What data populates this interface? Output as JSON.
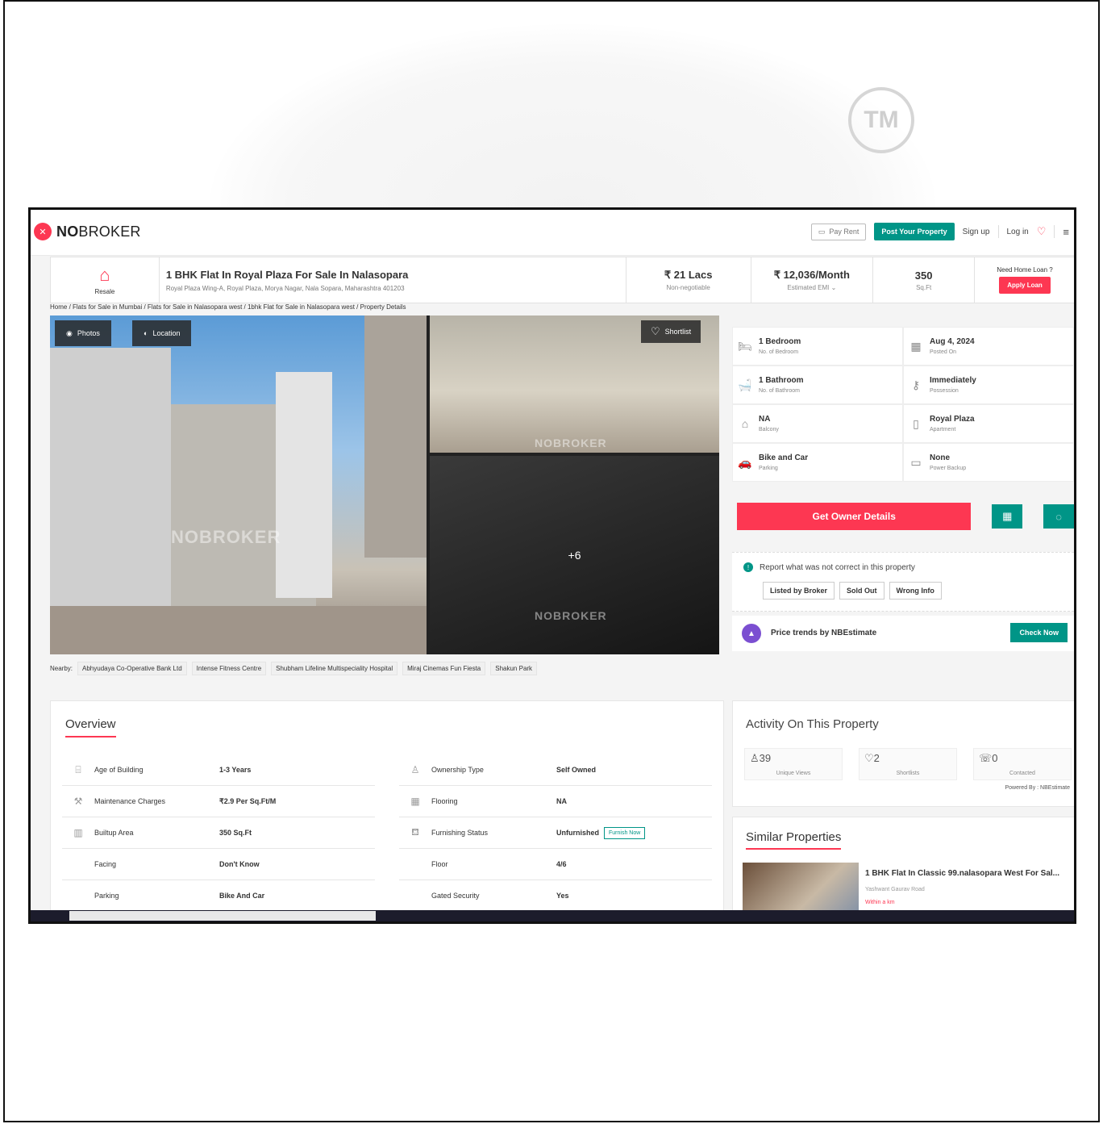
{
  "watermark": {
    "tm": "TM"
  },
  "topbar": {
    "logo_bold": "NO",
    "logo_rest": "BROKER",
    "pay_rent": "Pay Rent",
    "post_property": "Post Your Property",
    "sign_up": "Sign up",
    "log_in": "Log in"
  },
  "summary": {
    "resale": "Resale",
    "title": "1 BHK Flat In Royal Plaza For Sale In Nalasopara",
    "address": "Royal Plaza Wing-A, Royal Plaza, Morya Nagar, Nala Sopara, Maharashtra 401203",
    "price": "₹ 21 Lacs",
    "price_note": "Non-negotiable",
    "emi": "₹ 12,036/Month",
    "emi_note": "Estimated EMI",
    "area": "350",
    "area_unit": "Sq.Ft",
    "loan_q": "Need Home Loan ?",
    "apply_loan": "Apply Loan"
  },
  "breadcrumb": "Home / Flats for Sale in Mumbai / Flats for Sale in Nalasopara west / 1bhk Flat for Sale in Nalasopara west / Property Details",
  "gallery": {
    "photos": "Photos",
    "location": "Location",
    "shortlist": "Shortlist",
    "more": "+6",
    "watermark": "NOBROKER"
  },
  "nearby": {
    "label": "Nearby:",
    "items": [
      "Abhyudaya Co-Operative Bank Ltd",
      "Intense Fitness Centre",
      "Shubham Lifeline Multispeciality Hospital",
      "Miraj Cinemas Fun Fiesta",
      "Shakun Park"
    ]
  },
  "facts": [
    {
      "icon": "bed-icon",
      "glyph": "🛏",
      "value": "1 Bedroom",
      "label": "No. of Bedroom"
    },
    {
      "icon": "calendar-icon",
      "glyph": "▦",
      "value": "Aug 4, 2024",
      "label": "Posted On"
    },
    {
      "icon": "bath-icon",
      "glyph": "🛁",
      "value": "1 Bathroom",
      "label": "No. of Bathroom"
    },
    {
      "icon": "key-icon",
      "glyph": "⚷",
      "value": "Immediately",
      "label": "Possession"
    },
    {
      "icon": "balcony-icon",
      "glyph": "⌂",
      "value": "NA",
      "label": "Balcony"
    },
    {
      "icon": "building-icon",
      "glyph": "▯",
      "value": "Royal Plaza",
      "label": "Apartment"
    },
    {
      "icon": "car-icon",
      "glyph": "🚗",
      "value": "Bike and Car",
      "label": "Parking"
    },
    {
      "icon": "battery-icon",
      "glyph": "▭",
      "value": "None",
      "label": "Power Backup"
    }
  ],
  "owner": {
    "button": "Get Owner Details"
  },
  "report": {
    "text": "Report what was not correct in this property",
    "options": [
      "Listed by Broker",
      "Sold Out",
      "Wrong Info"
    ]
  },
  "trends": {
    "text": "Price trends by NBEstimate",
    "button": "Check Now"
  },
  "overview": {
    "title": "Overview",
    "left": [
      {
        "icon": "cake-icon",
        "glyph": "⌸",
        "label": "Age of Building",
        "value": "1-3 Years"
      },
      {
        "icon": "hammer-icon",
        "glyph": "⚒",
        "label": "Maintenance Charges",
        "value": "₹2.9 Per Sq.Ft/M"
      },
      {
        "icon": "builtup-icon",
        "glyph": "▥",
        "label": "Builtup Area",
        "value": "350 Sq.Ft"
      },
      {
        "icon": "",
        "glyph": "",
        "label": "Facing",
        "value": "Don't Know"
      },
      {
        "icon": "",
        "glyph": "",
        "label": "Parking",
        "value": "Bike And Car"
      }
    ],
    "right": [
      {
        "icon": "owner-icon",
        "glyph": "♙",
        "label": "Ownership Type",
        "value": "Self Owned"
      },
      {
        "icon": "flooring-icon",
        "glyph": "▦",
        "label": "Flooring",
        "value": "NA"
      },
      {
        "icon": "sofa-icon",
        "glyph": "⛾",
        "label": "Furnishing Status",
        "value": "Unfurnished"
      },
      {
        "icon": "",
        "glyph": "",
        "label": "Floor",
        "value": "4/6"
      },
      {
        "icon": "",
        "glyph": "",
        "label": "Gated Security",
        "value": "Yes"
      }
    ],
    "furnish_now": "Furnish Now"
  },
  "activity": {
    "title": "Activity On This Property",
    "views": "39",
    "views_label": "Unique Views",
    "shortlists": "2",
    "shortlists_label": "Shortlists",
    "contacted": "0",
    "contacted_label": "Contacted",
    "powered": "Powered By : NBEstimate"
  },
  "similar": {
    "title": "Similar Properties",
    "name": "1 BHK Flat In Classic 99.nalasopara West For Sal...",
    "road": "Yashwant Gaurav Road",
    "near": "Within a km"
  }
}
